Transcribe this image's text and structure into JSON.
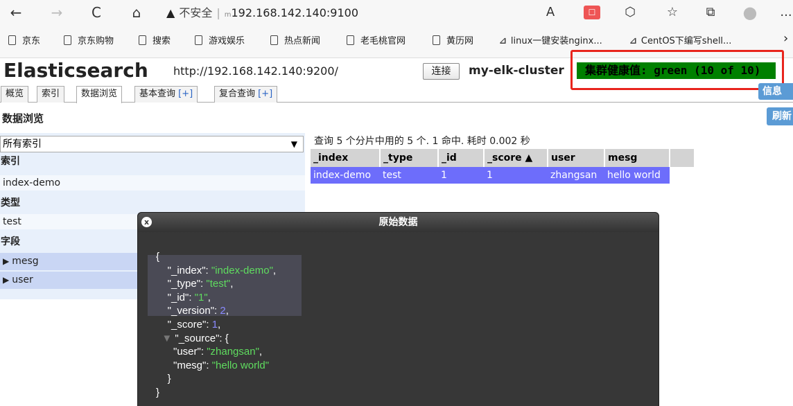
{
  "browser": {
    "nav": {
      "back": "←",
      "forward": "→",
      "reload": "C",
      "home": "⌂"
    },
    "address": {
      "warning_icon": "▲",
      "insecure_label": "不安全",
      "separator": "|",
      "host_prefix": "m",
      "url": "192.168.142.140:9100"
    },
    "toolbar_icons": {
      "read_aloud": "A",
      "extension": "☐",
      "puzzle": "⬡",
      "favorites": "☆",
      "collections": "⧉",
      "profile": "●",
      "more": "..."
    }
  },
  "bookmarks": [
    {
      "label": "京东",
      "icon": "page-icon"
    },
    {
      "label": "京东购物",
      "icon": "page-icon"
    },
    {
      "label": "搜索",
      "icon": "page-icon"
    },
    {
      "label": "游戏娱乐",
      "icon": "page-icon"
    },
    {
      "label": "热点新闻",
      "icon": "page-icon"
    },
    {
      "label": "老毛桃官网",
      "icon": "page-icon"
    },
    {
      "label": "黄历网",
      "icon": "page-icon"
    },
    {
      "label": "linux一键安装nginx...",
      "icon": "link-icon"
    },
    {
      "label": "CentOS下编写shell...",
      "icon": "link-icon"
    }
  ],
  "bookmarks_overflow": "›",
  "es": {
    "title": "Elasticsearch",
    "url": "http://192.168.142.140:9200/",
    "connect_label": "连接",
    "cluster_name": "my-elk-cluster",
    "health": "集群健康值: green (10 of 10)",
    "health_color": "#008000",
    "info_label": "信息",
    "refresh_label": "刷新"
  },
  "tabs": [
    {
      "label": "概览"
    },
    {
      "label": "索引"
    },
    {
      "label": "数据浏览",
      "active": true
    },
    {
      "label": "基本查询",
      "suffix": "[+]"
    },
    {
      "label": "复合查询",
      "suffix": "[+]"
    }
  ],
  "section_title": "数据浏览",
  "filter": {
    "index_select": "所有索引",
    "index_heading": "索引",
    "index_value": "index-demo",
    "type_heading": "类型",
    "type_value": "test",
    "fields_heading": "字段",
    "fields": [
      "mesg",
      "user"
    ]
  },
  "query_info": "查询 5 个分片中用的 5 个. 1 命中. 耗时 0.002 秒",
  "results": {
    "columns": [
      "_index",
      "_type",
      "_id",
      "_score ▲",
      "user",
      "mesg"
    ],
    "rows": [
      [
        "index-demo",
        "test",
        "1",
        "1",
        "zhangsan",
        "hello world"
      ]
    ]
  },
  "dialog": {
    "title": "原始数据",
    "close": "x",
    "doc": {
      "_index": "index-demo",
      "_type": "test",
      "_id": "1",
      "_version": "2",
      "_score": "1",
      "_source": {
        "user": "zhangsan",
        "mesg": "hello world"
      }
    }
  },
  "colors": {
    "selected_row": "#6d6dfb",
    "accent_button": "#5b9bd5",
    "highlight_box": "#e8251d"
  }
}
